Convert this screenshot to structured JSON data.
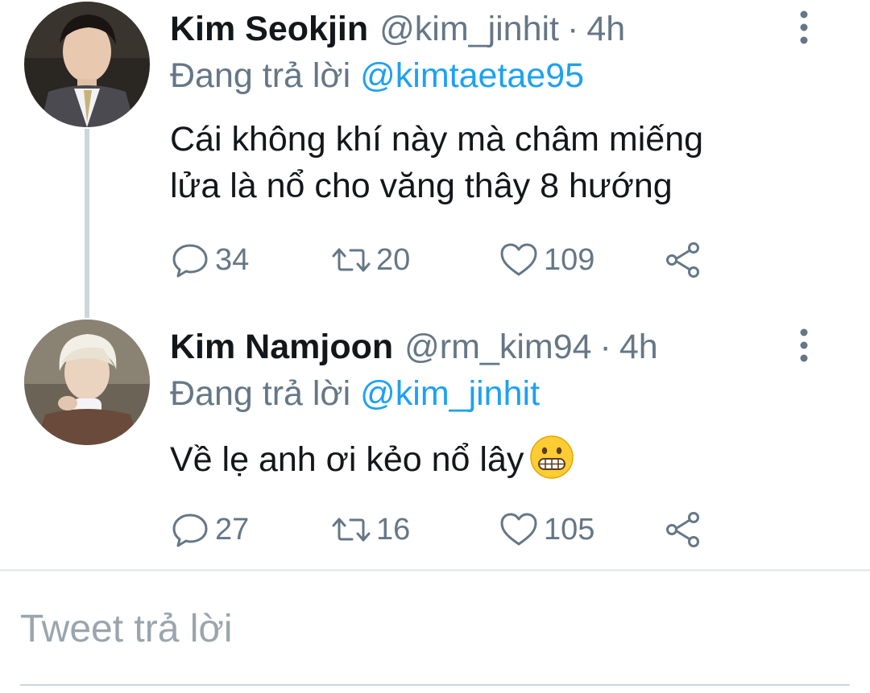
{
  "tweets": [
    {
      "display_name": "Kim Seokjin",
      "handle": "@kim_jinhit",
      "separator": "·",
      "time": "4h",
      "replying_prefix": "Đang trả lời",
      "replying_to": "@kimtaetae95",
      "body_lines": [
        "Cái không khí này mà châm miếng",
        "lửa là nổ cho văng thây 8 hướng"
      ],
      "replies": "34",
      "retweets": "20",
      "likes": "109"
    },
    {
      "display_name": "Kim Namjoon",
      "handle": "@rm_kim94",
      "separator": "·",
      "time": "4h",
      "replying_prefix": "Đang trả lời",
      "replying_to": "@kim_jinhit",
      "body_lines": [
        "Về lẹ anh ơi kẻo nổ lây"
      ],
      "emoji": "grimacing-face",
      "replies": "27",
      "retweets": "16",
      "likes": "105"
    }
  ],
  "reply_box": {
    "placeholder": "Tweet trả lời"
  },
  "colors": {
    "text": "#14171a",
    "secondary": "#657786",
    "link": "#1da1f2",
    "thread_line": "#ccd6dd",
    "placeholder": "#9aa5ad"
  },
  "icons": {
    "reply": "speech-bubble-icon",
    "retweet": "retweet-arrows-icon",
    "like": "heart-outline-icon",
    "share": "share-nodes-icon",
    "more": "vertical-ellipsis-icon"
  }
}
